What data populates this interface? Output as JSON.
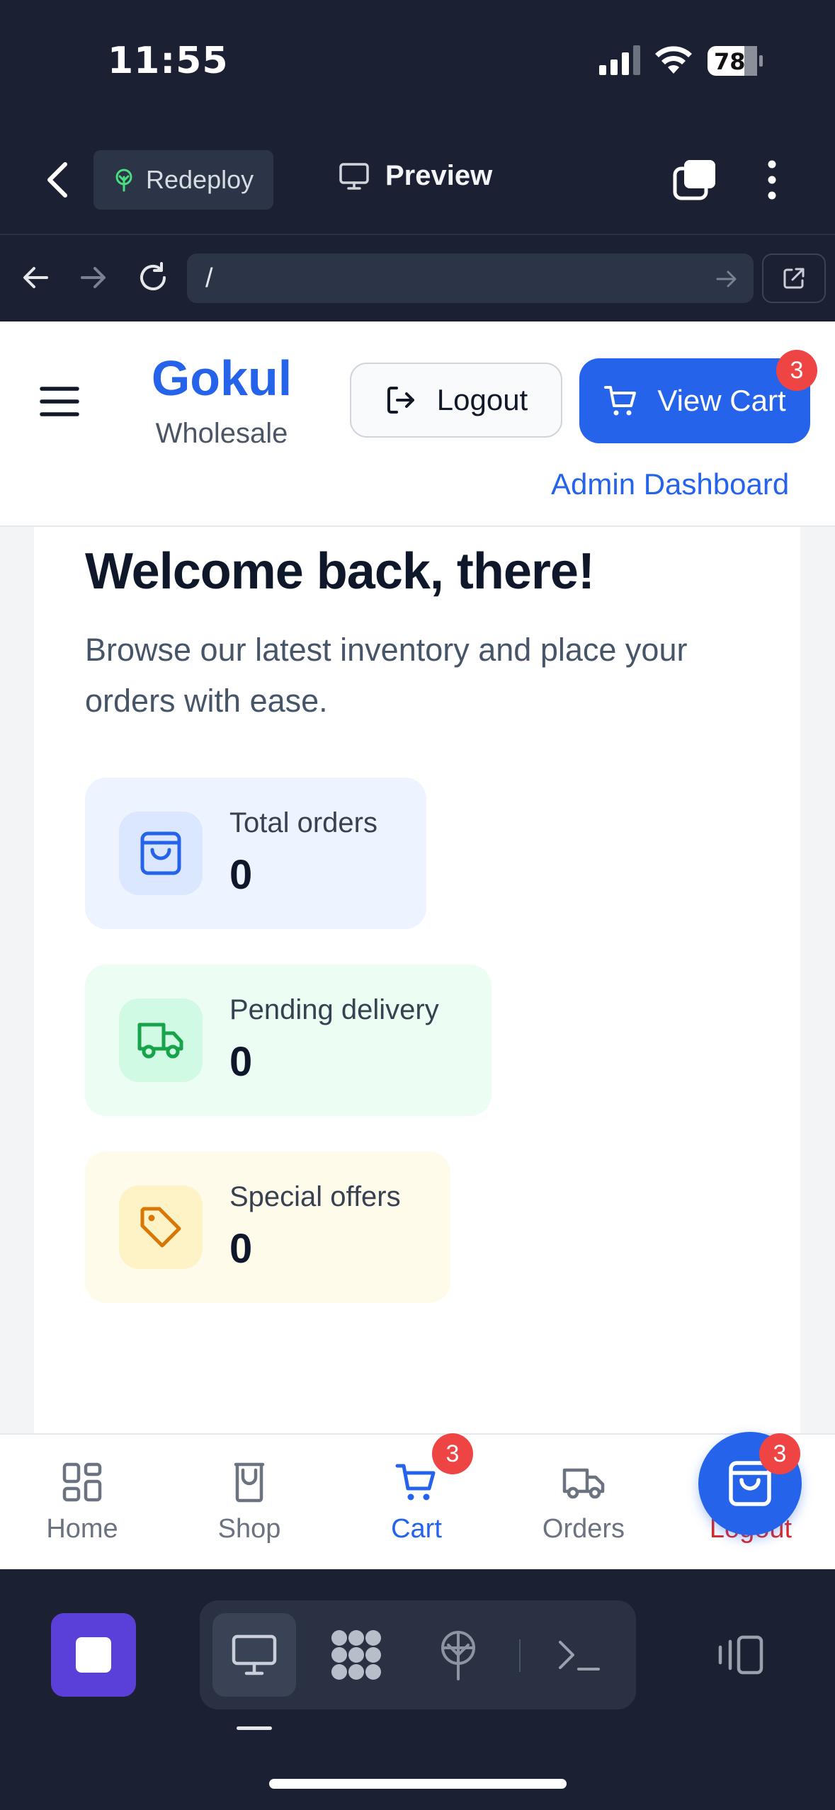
{
  "status_bar": {
    "time": "11:55",
    "battery": "78"
  },
  "toolbar": {
    "redeploy_label": "Redeploy",
    "preview_label": "Preview"
  },
  "url_bar": {
    "path": "/"
  },
  "header": {
    "brand_name": "Gokul",
    "brand_sub": "Wholesale",
    "logout_label": "Logout",
    "view_cart_label": "View Cart",
    "cart_badge": "3",
    "admin_link": "Admin Dashboard"
  },
  "welcome": {
    "title": "Welcome back, there!",
    "subtitle": "Browse our latest inventory and place your orders with ease."
  },
  "stats": [
    {
      "label": "Total orders",
      "value": "0",
      "icon": "shopping-bag-icon",
      "bg": "#eef4ff",
      "icon_bg": "#dbe7fe",
      "color": "#2563eb"
    },
    {
      "label": "Pending delivery",
      "value": "0",
      "icon": "truck-icon",
      "bg": "#ecfdf3",
      "icon_bg": "#d1fae5",
      "color": "#16a34a"
    },
    {
      "label": "Special offers",
      "value": "0",
      "icon": "tag-icon",
      "bg": "#fffbeb",
      "icon_bg": "#fef3c7",
      "color": "#d97706"
    }
  ],
  "bottom_nav": {
    "items": [
      {
        "label": "Home",
        "icon": "grid-icon"
      },
      {
        "label": "Shop",
        "icon": "shop-icon"
      },
      {
        "label": "Cart",
        "icon": "cart-icon",
        "active": true,
        "badge": "3"
      },
      {
        "label": "Orders",
        "icon": "truck-icon"
      },
      {
        "label": "Logout",
        "icon": "logout-icon",
        "color": "#dc2626"
      }
    ],
    "fab_badge": "3"
  },
  "colors": {
    "primary": "#2563eb",
    "danger": "#ef4444",
    "ide_bg": "#1b2133"
  }
}
